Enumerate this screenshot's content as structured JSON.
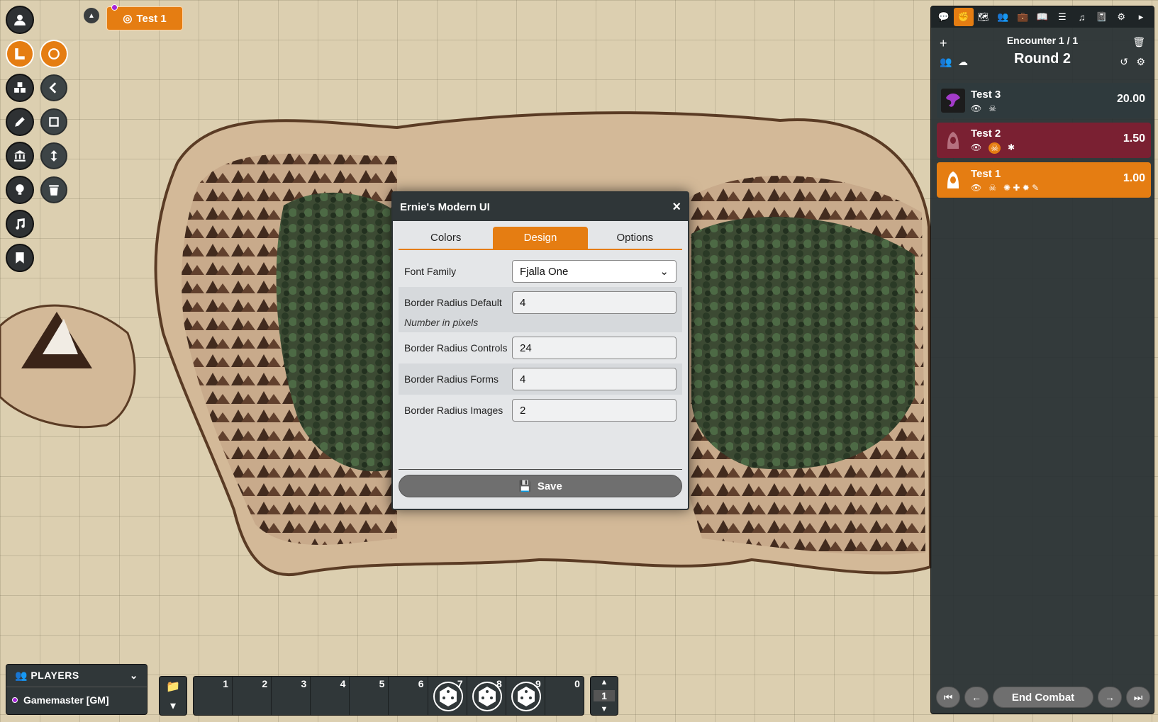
{
  "scene": {
    "active_tab": "Test 1"
  },
  "dialog": {
    "title": "Ernie's Modern UI",
    "close_icon": "×",
    "tabs": [
      "Colors",
      "Design",
      "Options"
    ],
    "active_tab": "Design",
    "fields": {
      "font_family": {
        "label": "Font Family",
        "value": "Fjalla One"
      },
      "radius_default": {
        "label": "Border Radius Default",
        "value": "4",
        "hint": "Number in pixels"
      },
      "radius_controls": {
        "label": "Border Radius Controls",
        "value": "24"
      },
      "radius_forms": {
        "label": "Border Radius Forms",
        "value": "4"
      },
      "radius_images": {
        "label": "Border Radius Images",
        "value": "2"
      }
    },
    "save_label": "Save"
  },
  "sidebar": {
    "encounter": "Encounter 1 / 1",
    "round": "Round 2",
    "combatants": [
      {
        "name": "Test 3",
        "initiative": "20.00",
        "color": "#2f3a3d"
      },
      {
        "name": "Test 2",
        "initiative": "1.50",
        "color": "#7a2032"
      },
      {
        "name": "Test 1",
        "initiative": "1.00",
        "color": "#e57d12"
      }
    ],
    "end_combat": "End Combat"
  },
  "players": {
    "header": "PLAYERS",
    "entries": [
      "Gamemaster [GM]"
    ]
  },
  "hotbar": {
    "slots": [
      "1",
      "2",
      "3",
      "4",
      "5",
      "6",
      "7",
      "8",
      "9",
      "0"
    ],
    "page": "1"
  },
  "colors": {
    "accent": "#e57d12",
    "dark": "#2f3638",
    "danger": "#7a2032"
  }
}
